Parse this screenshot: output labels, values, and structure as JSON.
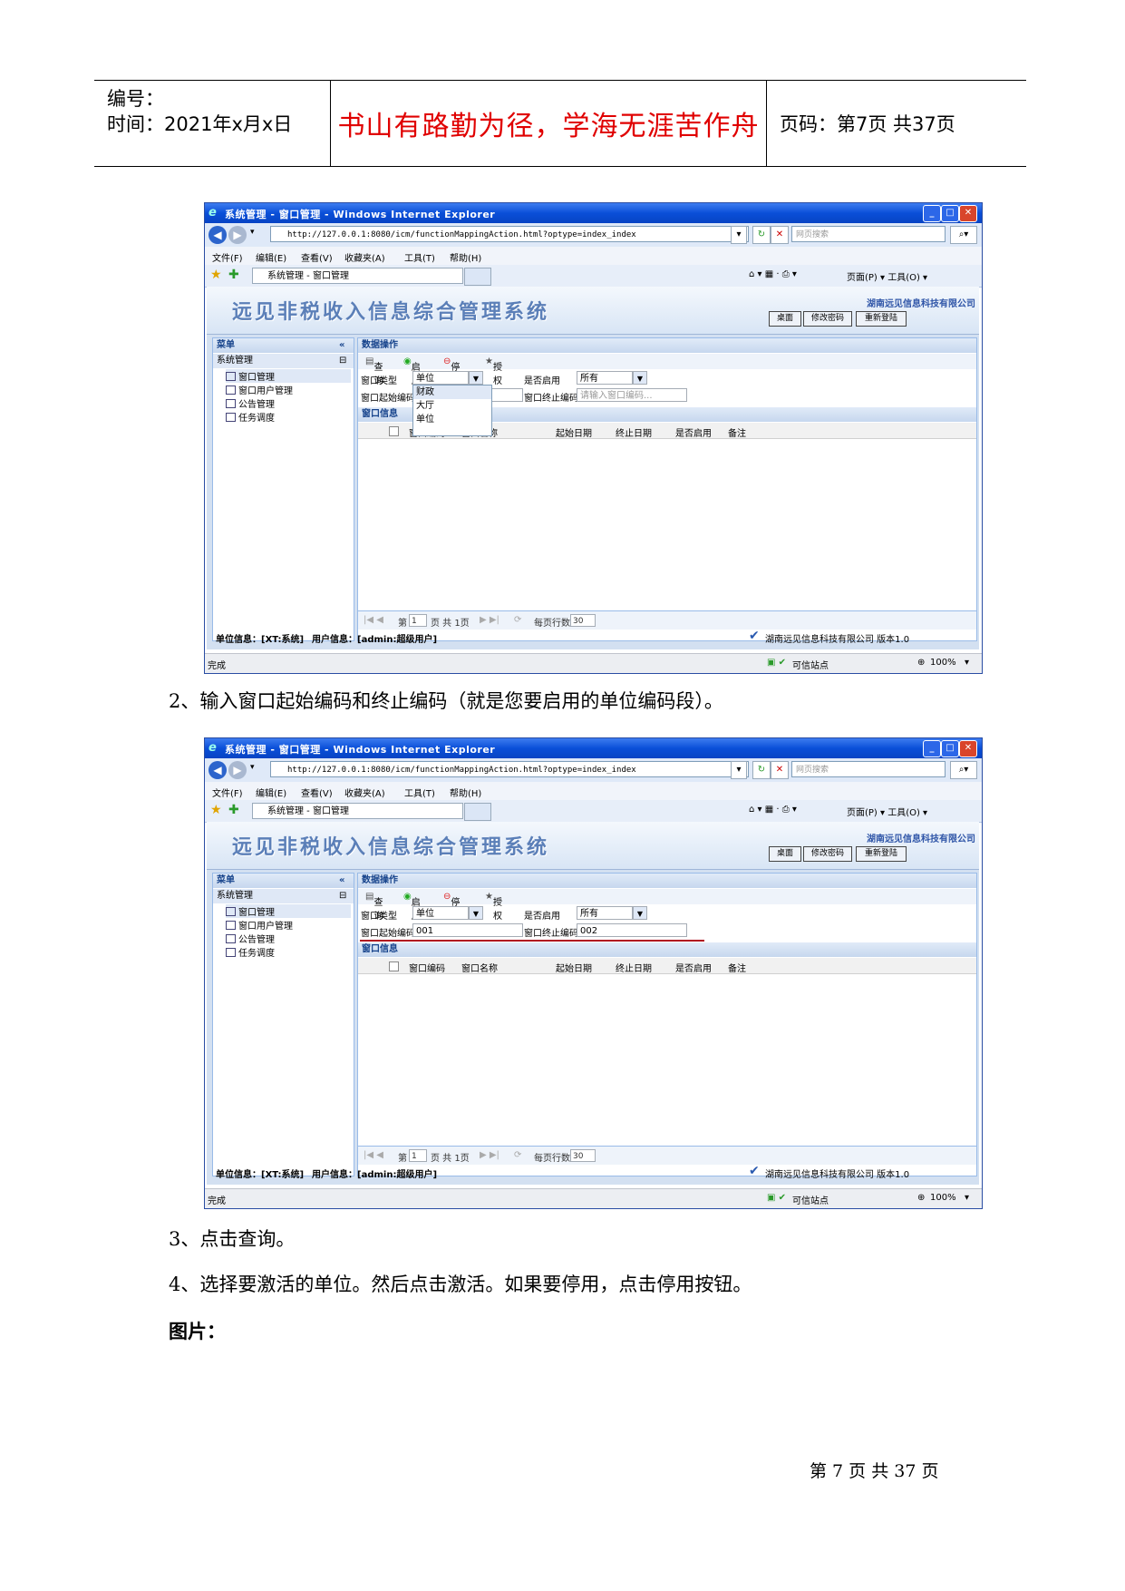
{
  "header": {
    "number_label": "编号：",
    "time_label": "时间：2021年x月x日",
    "motto": "书山有路勤为径，学海无涯苦作舟",
    "page_info": "页码：第7页  共37页"
  },
  "screenshots": [
    {
      "window_title": "系统管理 - 窗口管理 - Windows Internet Explorer",
      "url": "http://127.0.0.1:8080/icm/functionMappingAction.html?optype=index_index",
      "search_placeholder": "网页搜索",
      "menu": [
        "文件(F)",
        "编辑(E)",
        "查看(V)",
        "收藏夹(A)",
        "工具(T)",
        "帮助(H)"
      ],
      "tab_title": "系统管理 - 窗口管理",
      "right_tools": "页面(P) ▾  工具(O) ▾",
      "brand": "远见非税收入信息综合管理系统",
      "company": "湖南远见信息科技有限公司",
      "banner_buttons": [
        "桌面",
        "修改密码",
        "重新登陆"
      ],
      "sidebar_title": "菜单",
      "sidebar_group": "系统管理",
      "sidebar_items": [
        "窗口管理",
        "窗口用户管理",
        "公告管理",
        "任务调度"
      ],
      "panel_title": "数据操作",
      "toolbar": [
        "查询",
        "启用",
        "停用",
        "授权"
      ],
      "form": {
        "type_label": "窗口类型",
        "type_value": "单位",
        "enabled_label": "是否启用",
        "enabled_value": "所有",
        "start_label": "窗口起始编码",
        "start_value": "",
        "end_label": "窗口终止编码",
        "end_value": "",
        "end_placeholder": "请输入窗口编码..."
      },
      "dropdown_open": true,
      "dropdown_options": [
        "财政",
        "大厅",
        "单位"
      ],
      "info_title": "窗口信息",
      "columns": [
        "窗口编码",
        "窗口名称",
        "起始日期",
        "终止日期",
        "是否启用",
        "备注"
      ],
      "pager": {
        "page_label": "第",
        "page_value": "1",
        "total": "页 共 1页",
        "rows_label": "每页行数",
        "rows_value": "30"
      },
      "unit_info": "单位信息：[XT:系统]",
      "user_info": "用户信息：[admin:超级用户]",
      "version": "湖南远见信息科技有限公司  版本1.0",
      "status_left": "完成",
      "status_site": "可信站点",
      "zoom": "100%"
    },
    {
      "window_title": "系统管理 - 窗口管理 - Windows Internet Explorer",
      "url": "http://127.0.0.1:8080/icm/functionMappingAction.html?optype=index_index",
      "search_placeholder": "网页搜索",
      "menu": [
        "文件(F)",
        "编辑(E)",
        "查看(V)",
        "收藏夹(A)",
        "工具(T)",
        "帮助(H)"
      ],
      "tab_title": "系统管理 - 窗口管理",
      "right_tools": "页面(P) ▾  工具(O) ▾",
      "brand": "远见非税收入信息综合管理系统",
      "company": "湖南远见信息科技有限公司",
      "banner_buttons": [
        "桌面",
        "修改密码",
        "重新登陆"
      ],
      "sidebar_title": "菜单",
      "sidebar_group": "系统管理",
      "sidebar_items": [
        "窗口管理",
        "窗口用户管理",
        "公告管理",
        "任务调度"
      ],
      "panel_title": "数据操作",
      "toolbar": [
        "查询",
        "启用",
        "停用",
        "授权"
      ],
      "form": {
        "type_label": "窗口类型",
        "type_value": "单位",
        "enabled_label": "是否启用",
        "enabled_value": "所有",
        "start_label": "窗口起始编码",
        "start_value": "001",
        "end_label": "窗口终止编码",
        "end_value": "002",
        "end_placeholder": ""
      },
      "dropdown_open": false,
      "dropdown_options": [],
      "info_title": "窗口信息",
      "columns": [
        "窗口编码",
        "窗口名称",
        "起始日期",
        "终止日期",
        "是否启用",
        "备注"
      ],
      "pager": {
        "page_label": "第",
        "page_value": "1",
        "total": "页 共 1页",
        "rows_label": "每页行数",
        "rows_value": "30"
      },
      "unit_info": "单位信息：[XT:系统]",
      "user_info": "用户信息：[admin:超级用户]",
      "version": "湖南远见信息科技有限公司  版本1.0",
      "status_left": "完成",
      "status_site": "可信站点",
      "zoom": "100%"
    }
  ],
  "body": {
    "step2": "2、输入窗口起始编码和终止编码（就是您要启用的单位编码段）。",
    "step3": "3、点击查询。",
    "step4": "4、选择要激活的单位。然后点击激活。如果要停用，点击停用按钮。",
    "pictures_label": "图片："
  },
  "footer": {
    "page": "第 7 页 共 37 页"
  }
}
